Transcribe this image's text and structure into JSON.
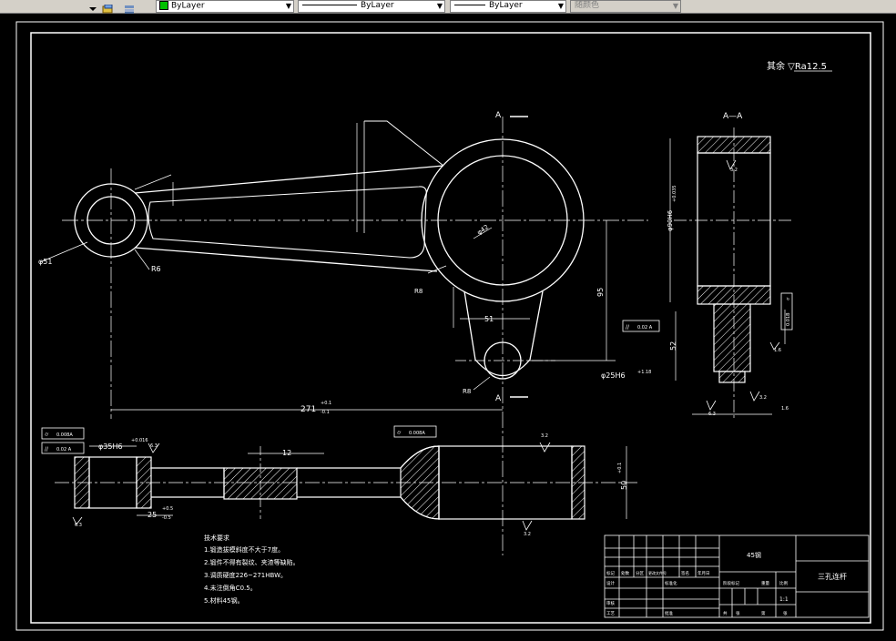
{
  "toolbar": {
    "layer_dropdown": "ByLayer",
    "linetype_dropdown": "ByLayer",
    "lineweight_dropdown": "ByLayer",
    "plotstyle_dropdown": "随颜色",
    "layer_color": "#00c000"
  },
  "drawing": {
    "roughness_note": "其余 ▽Ra12.5",
    "section_label": "A—A",
    "section_mark_top": "A",
    "section_mark_bottom": "A",
    "dims": {
      "d51": "φ51",
      "r6": "R6",
      "r8_left": "R8",
      "d42": "φ42",
      "d51_lower": "51",
      "r8_lower": "R8",
      "h95": "95",
      "len271": "271",
      "len271_tol_up": "+0.1",
      "len271_tol_dn": "-0.1",
      "d35h6": "φ35H6",
      "d35h6_tol": "+0.016",
      "d25h6": "φ25H6",
      "d25h6_tol": "+1.18",
      "w25": "25",
      "w25_tol_up": "+0.5",
      "w25_tol_dn": "-0.5",
      "w12": "12",
      "h50": "50",
      "h50_tol": "+0.1",
      "d90h6": "φ90H6",
      "d90h6_tol": "+0.035",
      "s52": "52",
      "ra_a": "3.2",
      "ra_b": "1.6",
      "ra_c": "6.3",
      "ra_d": "3.2",
      "ra_e": "1.6",
      "ra_f": "6.3",
      "ra_g": "6.3",
      "ra_h": "3.2",
      "ra_i": "3.2"
    },
    "tolerance_frames": [
      {
        "symbol": "⌭",
        "value": "0.008A"
      },
      {
        "symbol": "//",
        "value": "0.02 A"
      },
      {
        "symbol": "⌭",
        "value": "0.008A"
      },
      {
        "symbol": "//",
        "value": "0.02 A"
      },
      {
        "symbol": "⌭",
        "value": "0.01B"
      }
    ],
    "tech_notes": {
      "title": "技术要求",
      "items": [
        "1.锻造拔模斜度不大于7度。",
        "2.锻件不得有裂纹、夹渣等缺陷。",
        "3.调质硬度226~271HBW。",
        "4.未注倒角C0.5。",
        "5.材料45钢。"
      ]
    },
    "title_block": {
      "material": "45钢",
      "part_name": "三孔连杆",
      "scale": "1:1",
      "labels": [
        "标记",
        "处数",
        "分区",
        "更改文件号",
        "签名",
        "年月日",
        "设计",
        "标准化",
        "审核",
        "工艺",
        "批准",
        "阶段标记",
        "重量",
        "比例",
        "共",
        "张",
        "第",
        "张"
      ]
    }
  }
}
